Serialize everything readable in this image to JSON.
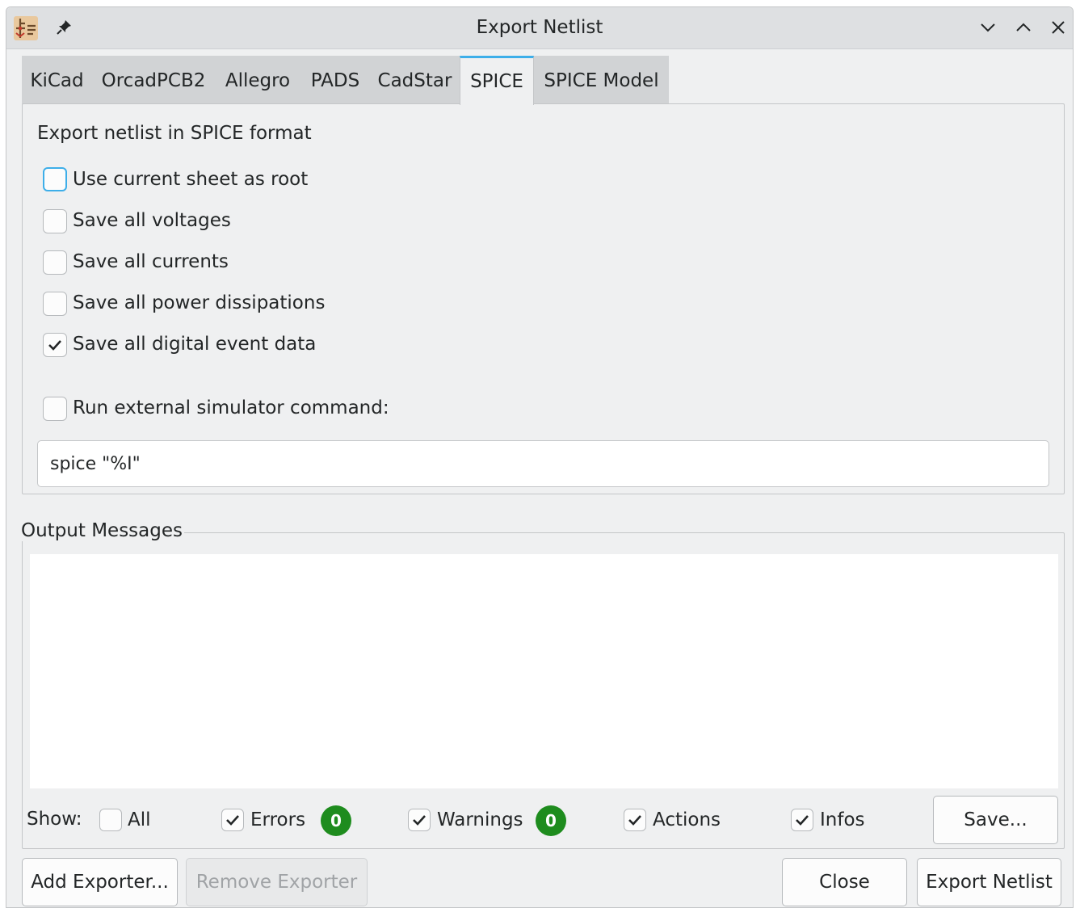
{
  "window": {
    "title": "Export Netlist",
    "icons": {
      "app": "kicad-schematic-icon",
      "pin": "pin-icon",
      "minimize": "chevron-down-icon",
      "maximize": "chevron-up-icon",
      "close": "close-icon"
    }
  },
  "tabs": [
    {
      "label": "KiCad"
    },
    {
      "label": "OrcadPCB2"
    },
    {
      "label": "Allegro"
    },
    {
      "label": "PADS"
    },
    {
      "label": "CadStar"
    },
    {
      "label": "SPICE"
    },
    {
      "label": "SPICE Model"
    }
  ],
  "active_tab": "SPICE",
  "spice": {
    "heading": "Export netlist in SPICE format",
    "options": [
      {
        "label": "Use current sheet as root",
        "checked": false
      },
      {
        "label": "Save all voltages",
        "checked": false
      },
      {
        "label": "Save all currents",
        "checked": false
      },
      {
        "label": "Save all power dissipations",
        "checked": false
      },
      {
        "label": "Save all digital event data",
        "checked": true
      }
    ],
    "run_command": {
      "label": "Run external simulator command:",
      "checked": false
    },
    "command_value": "spice \"%I\""
  },
  "output": {
    "group_title": "Output Messages",
    "show_label": "Show:",
    "filters": {
      "all": {
        "label": "All",
        "checked": false
      },
      "errors": {
        "label": "Errors",
        "checked": true,
        "count": "0"
      },
      "warnings": {
        "label": "Warnings",
        "checked": true,
        "count": "0"
      },
      "actions": {
        "label": "Actions",
        "checked": true
      },
      "infos": {
        "label": "Infos",
        "checked": true
      }
    },
    "save_label": "Save..."
  },
  "footer": {
    "add_exporter": "Add Exporter...",
    "remove_exporter": "Remove Exporter",
    "close": "Close",
    "export_netlist": "Export Netlist"
  },
  "colors": {
    "accent": "#3daee9",
    "badge": "#1e8c1e",
    "window_bg": "#eff0f1"
  }
}
